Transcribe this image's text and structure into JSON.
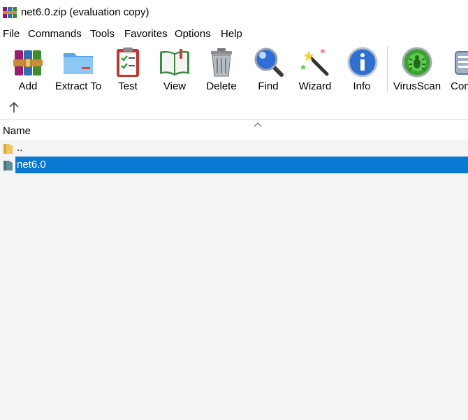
{
  "window": {
    "title": "net6.0.zip (evaluation copy)",
    "app_icon": "winrar-books-icon"
  },
  "menu": [
    "File",
    "Commands",
    "Tools",
    "Favorites",
    "Options",
    "Help"
  ],
  "toolbar": {
    "buttons": [
      {
        "label": "Add",
        "icon": "add-archive-icon"
      },
      {
        "label": "Extract To",
        "icon": "extract-folder-icon"
      },
      {
        "label": "Test",
        "icon": "test-clipboard-icon"
      },
      {
        "label": "View",
        "icon": "view-book-icon"
      },
      {
        "label": "Delete",
        "icon": "trash-icon"
      },
      {
        "label": "Find",
        "icon": "magnifier-icon"
      },
      {
        "label": "Wizard",
        "icon": "magic-wand-icon"
      },
      {
        "label": "Info",
        "icon": "info-icon"
      },
      {
        "label": "VirusScan",
        "icon": "virus-scan-icon"
      },
      {
        "label": "Com",
        "icon": "comment-icon"
      }
    ],
    "up_icon": "up-arrow-icon"
  },
  "list": {
    "columns": [
      "Name"
    ],
    "sort_icon": "sort-caret-icon",
    "rows": [
      {
        "name": "..",
        "icon": "folder-icon",
        "selected": false
      },
      {
        "name": "net6.0",
        "icon": "folder-icon",
        "selected": true
      }
    ]
  },
  "colors": {
    "selection": "#0a79d4",
    "list_background": "#f4f4f4"
  }
}
